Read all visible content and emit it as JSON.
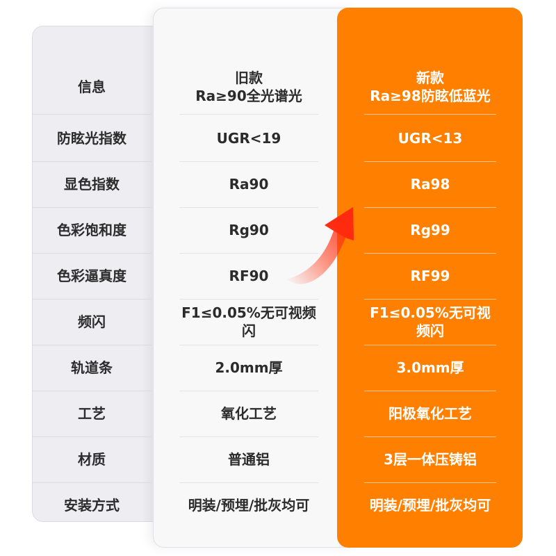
{
  "rows": [
    {
      "label": "信息",
      "old_line1": "旧款",
      "old_line2": "Ra≥90全光谱光",
      "new_line1": "新款",
      "new_line2": "Ra≥98防眩低蓝光"
    },
    {
      "label": "防眩光指数",
      "old": "UGR<19",
      "new": "UGR<13"
    },
    {
      "label": "显色指数",
      "old": "Ra90",
      "new": "Ra98"
    },
    {
      "label": "色彩饱和度",
      "old": "Rg90",
      "new": "Rg99"
    },
    {
      "label": "色彩逼真度",
      "old": "RF90",
      "new": "RF99"
    },
    {
      "label": "频闪",
      "old": "F1≤0.05%无可视频闪",
      "new": "F1≤0.05%无可视频闪"
    },
    {
      "label": "轨道条",
      "old": "2.0mm厚",
      "new": "3.0mm厚"
    },
    {
      "label": "工艺",
      "old": "氧化工艺",
      "new": "阳极氧化工艺"
    },
    {
      "label": "材质",
      "old": "普通铝",
      "new": "3层一体压铸铝"
    },
    {
      "label": "安装方式",
      "old": "明装/预埋/批灰均可",
      "new": "明装/预埋/批灰均可"
    }
  ],
  "colors": {
    "accent": "#ff8000",
    "label_bg": "#eeeef2",
    "old_bg": "#f8f8f9",
    "arrow": "#ff3b1a"
  },
  "icons": {
    "arrow": "upgrade-arrow-icon"
  }
}
